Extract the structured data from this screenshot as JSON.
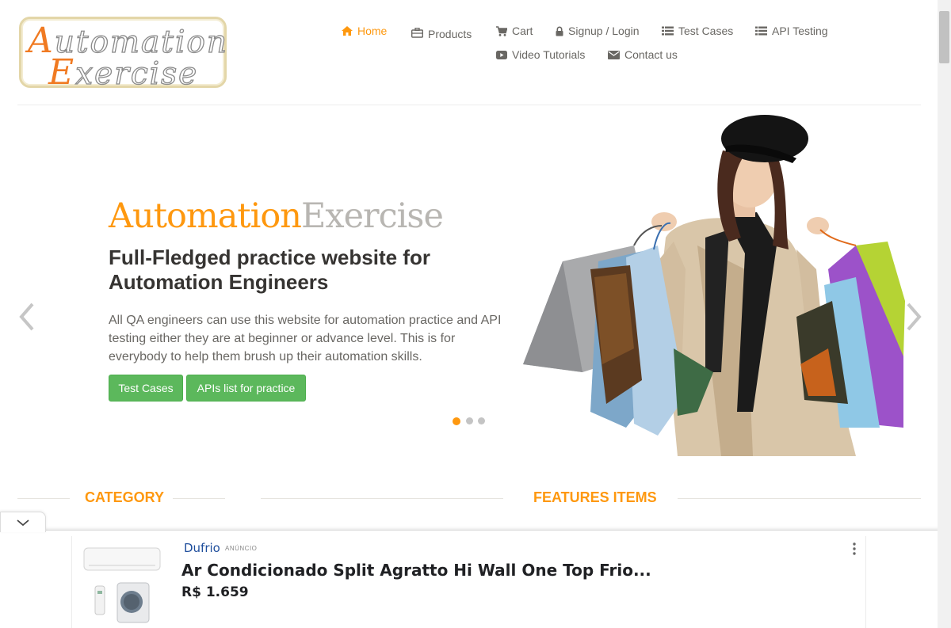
{
  "logo": {
    "line1_cap": "A",
    "line1_rest": "utomation",
    "line2_cap": "E",
    "line2_rest": "xercise"
  },
  "nav": {
    "home": "Home",
    "products": "Products",
    "cart": "Cart",
    "signup_login": "Signup / Login",
    "test_cases": "Test Cases",
    "api_testing": "API Testing",
    "video_tutorials": "Video Tutorials",
    "contact_us": "Contact us"
  },
  "slider": {
    "brand_orange": "Automation",
    "brand_grey": "Exercise",
    "title": "Full-Fledged practice website for Automation Engineers",
    "text": "All QA engineers can use this website for automation practice and API testing either they are at beginner or advance level. This is for everybody to help them brush up their automation skills.",
    "btn_test_cases": "Test Cases",
    "btn_apis": "APIs list for practice",
    "active_slide": 1,
    "slide_count": 3
  },
  "sections": {
    "category": "CATEGORY",
    "features": "FEATURES ITEMS"
  },
  "ad": {
    "brand": "Dufrio",
    "label": "ANÚNCIO",
    "title": "Ar Condicionado Split Agratto Hi Wall One Top Frio...",
    "price": "R$ 1.659"
  },
  "colors": {
    "accent": "#fe980f",
    "button_green": "#5cb85c",
    "nav_text": "#696763"
  }
}
